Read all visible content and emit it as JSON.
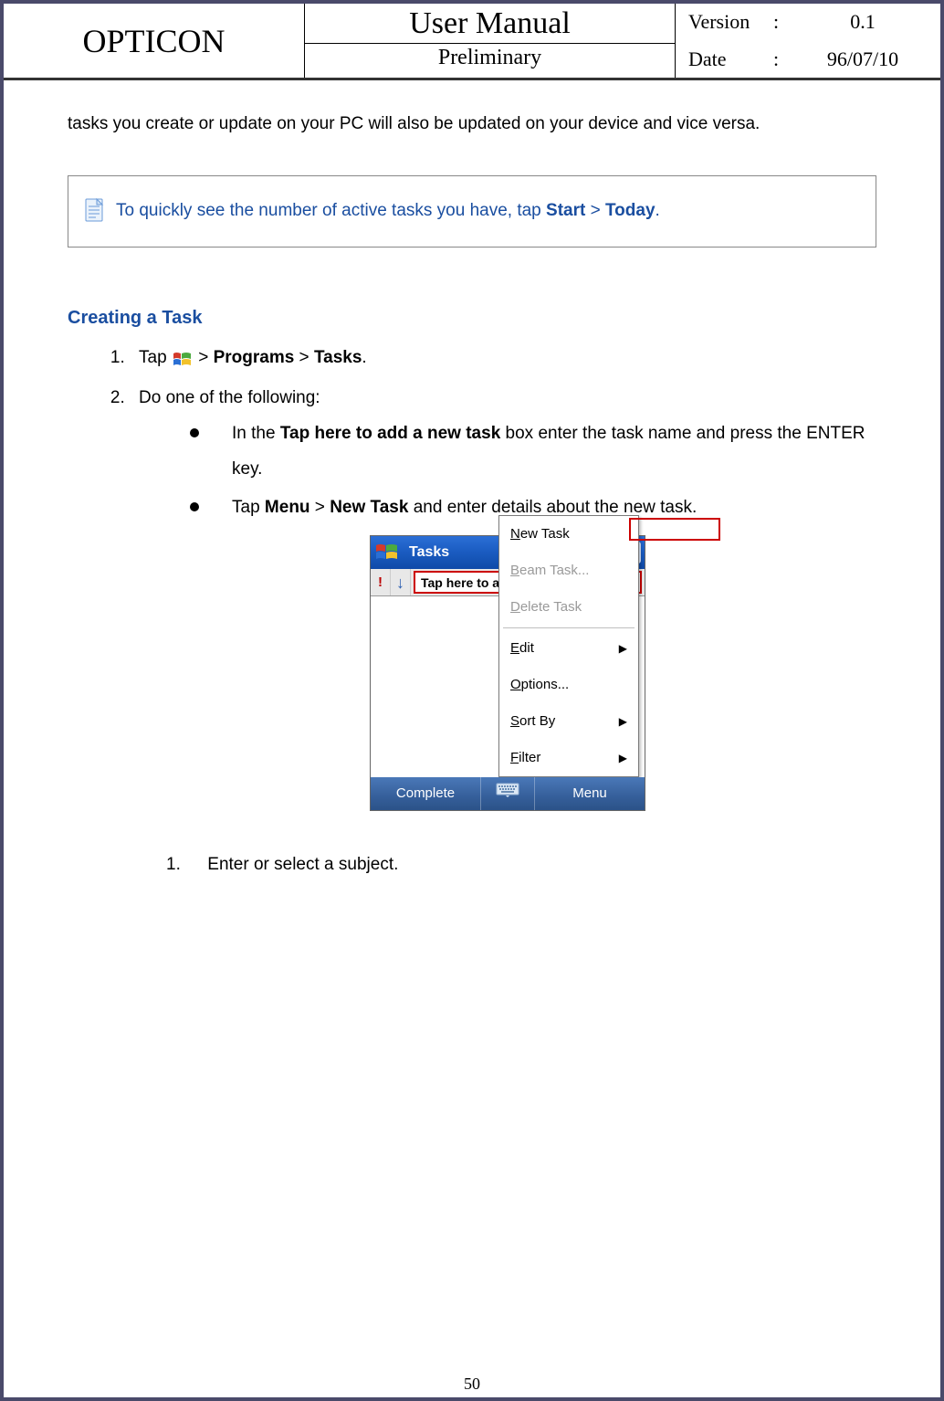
{
  "header": {
    "brand": "OPTICON",
    "title": "User Manual",
    "subtitle": "Preliminary",
    "versionLabel": "Version",
    "versionValue": "0.1",
    "dateLabel": "Date",
    "dateValue": "96/07/10",
    "colon": ":"
  },
  "intro": "tasks you create or update on your PC will also be updated on your device and vice versa.",
  "note": {
    "prefix": " To quickly see the number of active tasks you have, tap ",
    "b1": "Start",
    "mid": " > ",
    "b2": "Today",
    "suffix": "."
  },
  "section_heading": "Creating a Task",
  "steps": {
    "s1": {
      "pre": "Tap ",
      "b1": "Programs",
      "mid": " > ",
      "b2": "Tasks",
      "post": ".",
      "gtpre": " > "
    },
    "s2": "Do one of the following:",
    "bullets": {
      "b1": {
        "pre": "In the ",
        "bold": "Tap here to add a new task",
        "post": " box enter the task name and press the ENTER key."
      },
      "b2": {
        "pre": "Tap ",
        "b1": "Menu",
        "mid": " > ",
        "b2": "New Task",
        "post": " and enter details about the new task."
      }
    }
  },
  "device": {
    "title": "Tasks",
    "input_placeholder": "Tap here to add a new task",
    "exclaim": "!",
    "arrow": "↓",
    "menu": {
      "new_task": "New Task",
      "beam_task": "Beam Task...",
      "delete_task": "Delete Task",
      "edit": "Edit",
      "options": "Options...",
      "sort_by": "Sort By",
      "filter": "Filter"
    },
    "bottombar": {
      "left": "Complete",
      "right": "Menu"
    }
  },
  "substep": {
    "num": "1.",
    "text": "Enter or select a subject."
  },
  "page_number": "50"
}
